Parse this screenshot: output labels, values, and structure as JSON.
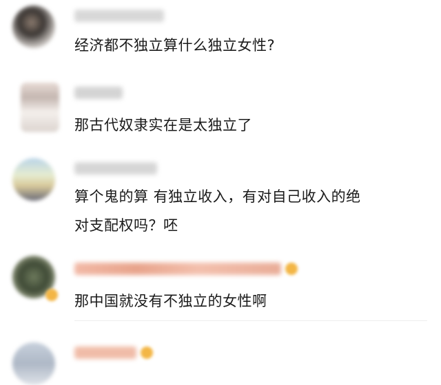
{
  "comments": [
    {
      "text": "经济都不独立算什么独立女性?"
    },
    {
      "text": "那古代奴隶实在是太独立了"
    },
    {
      "text_line1": "算个鬼的算 有独立收入，有对自己收入的绝",
      "text_line2": "对支配权吗？呸"
    },
    {
      "text": "那中国就没有不独立的女性啊"
    },
    {
      "text": ""
    }
  ]
}
